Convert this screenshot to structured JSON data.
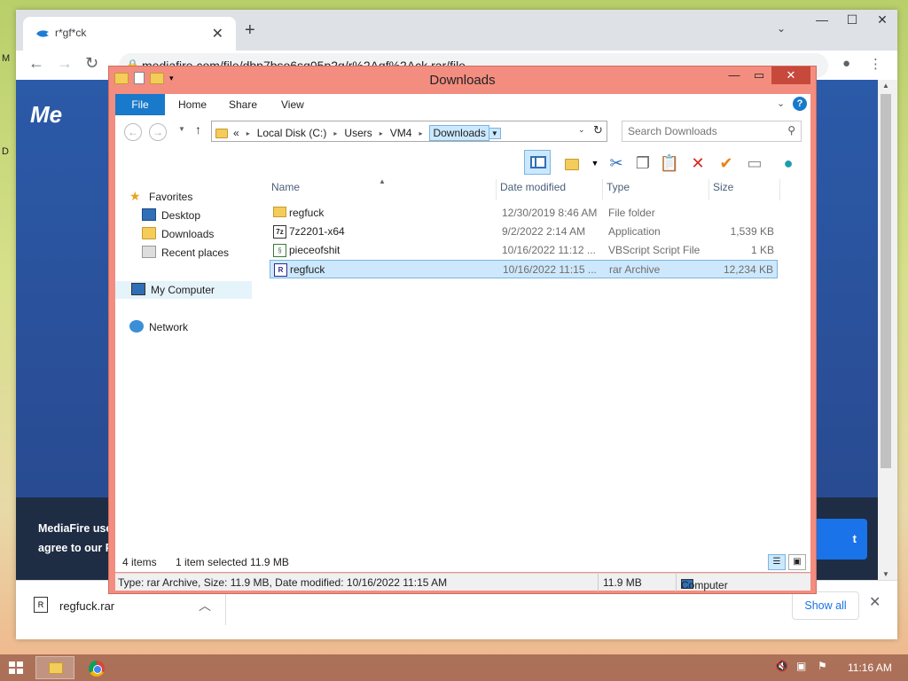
{
  "chrome": {
    "tab_title": "r*gf*ck",
    "url": "mediafire.com/file/dbp7bso6sq05p2q/r%2Agf%2Ack.rar/file",
    "tab_close": "✕",
    "new_tab": "+",
    "window_min": "—",
    "window_max": "☐",
    "window_close": "✕"
  },
  "mediafire": {
    "logo": "Me",
    "cookie_line1": "MediaFire use",
    "cookie_line2": "agree to our P",
    "accept_label": "t"
  },
  "download_shelf": {
    "file_name": "regfuck.rar",
    "show_all": "Show all"
  },
  "explorer": {
    "title": "Downloads",
    "ribbon_tabs": [
      "File",
      "Home",
      "Share",
      "View"
    ],
    "breadcrumb": {
      "prefix": "«",
      "parts": [
        "Local Disk (C:)",
        "Users",
        "VM4"
      ],
      "current": "Downloads"
    },
    "search_placeholder": "Search Downloads",
    "nav": {
      "favorites": "Favorites",
      "desktop": "Desktop",
      "downloads": "Downloads",
      "recent": "Recent places",
      "computer": "My Computer",
      "network": "Network"
    },
    "columns": [
      "Name",
      "Date modified",
      "Type",
      "Size"
    ],
    "files": [
      {
        "name": "regfuck",
        "date": "12/30/2019 8:46 AM",
        "type": "File folder",
        "size": "",
        "icon": "folder-icon"
      },
      {
        "name": "7z2201-x64",
        "date": "9/2/2022 2:14 AM",
        "type": "Application",
        "size": "1,539 KB",
        "icon": "app-icon"
      },
      {
        "name": "pieceofshit",
        "date": "10/16/2022 11:12 ...",
        "type": "VBScript Script File",
        "size": "1 KB",
        "icon": "vbscript-icon"
      },
      {
        "name": "regfuck",
        "date": "10/16/2022 11:15 ...",
        "type": "rar Archive",
        "size": "12,234 KB",
        "icon": "rar-icon",
        "selected": true
      }
    ],
    "status": {
      "item_count": "4 items",
      "selection": "1 item selected  11.9 MB"
    },
    "details_bar": {
      "info": "Type: rar Archive, Size: 11.9 MB, Date modified: 10/16/2022 11:15 AM",
      "size": "11.9 MB",
      "location": "Computer"
    }
  },
  "taskbar": {
    "clock": "11:16 AM"
  },
  "colors": {
    "explorer_frame": "#f38d80",
    "ribbon_file_tab": "#1979ca",
    "selection": "#cde8fc",
    "mediafire_blue": "#2b5aa8"
  }
}
